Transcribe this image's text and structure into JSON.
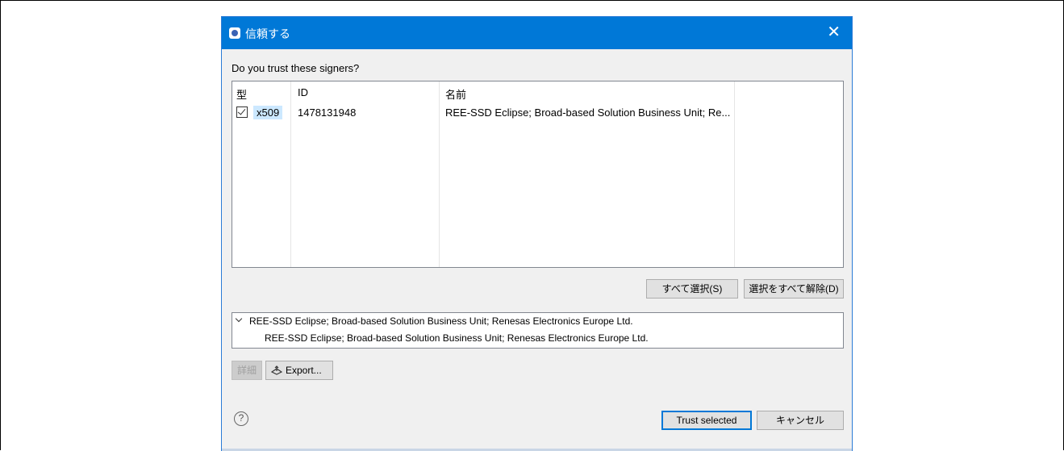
{
  "window": {
    "title": "信頼する",
    "close_glyph": "✕",
    "app_icon": "eclipse-app-icon"
  },
  "prompt": "Do you trust these signers?",
  "table": {
    "columns": [
      "型",
      "ID",
      "名前"
    ],
    "rows": [
      {
        "checked": true,
        "type": "x509",
        "id": "1478131948",
        "name": "REE-SSD Eclipse; Broad-based Solution Business Unit; Re..."
      }
    ]
  },
  "selection_buttons": {
    "select_all": "すべて選択(S)",
    "deselect_all": "選択をすべて解除(D)"
  },
  "tree": {
    "parent": "REE-SSD Eclipse; Broad-based Solution Business Unit; Renesas Electronics Europe Ltd.",
    "child": "REE-SSD Eclipse; Broad-based Solution Business Unit; Renesas Electronics Europe Ltd."
  },
  "detail_buttons": {
    "details": "詳細",
    "export": "Export..."
  },
  "footer": {
    "help_glyph": "?",
    "trust_selected": "Trust selected",
    "cancel": "キャンセル"
  },
  "colors": {
    "titlebar": "#0078d7",
    "selection": "#cce8ff",
    "dialog_bg": "#f0f0f0"
  }
}
